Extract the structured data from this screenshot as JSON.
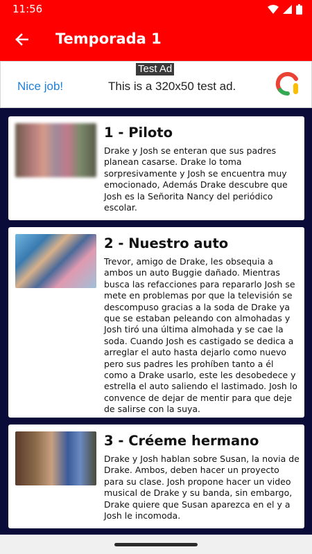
{
  "status_bar": {
    "time": "11:56"
  },
  "app_bar": {
    "title": "Temporada 1",
    "back_icon": "arrow-back-icon"
  },
  "ad": {
    "tag": "Test Ad",
    "nice": "Nice job!",
    "text": "This is a 320x50 test ad."
  },
  "episodes": [
    {
      "title": "1 - Piloto",
      "description": "Drake y Josh se enteran que sus padres planean casarse. Drake lo toma sorpresivamente y Josh se encuentra muy emocionado, Además Drake descubre que Josh es la Señorita Nancy del periódico escolar."
    },
    {
      "title": "2 - Nuestro auto",
      "description": "Trevor, amigo de Drake, les obsequia a ambos un auto Buggie dañado. Mientras busca las refacciones para repararlo Josh se mete en problemas por que la televisión se descompuso gracias a la soda de Drake ya que se estaban peleando con almohadas y Josh tiró una última almohada y se cae la soda. Cuando Josh es castigado se dedica a arreglar el auto hasta dejarlo como nuevo pero sus padres les prohíben tanto a él como a Drake usarlo, este les desobedece y estrella el auto saliendo el lastimado. Josh lo convence de dejar de mentir para que deje de salirse con la suya."
    },
    {
      "title": "3 - Créeme hermano",
      "description": "Drake y Josh hablan sobre Susan, la novia de Drake. Ambos, deben hacer un proyecto para su clase. Josh propone hacer un video musical de Drake y su banda, sin embargo, Drake quiere que Susan aparezca en el y a Josh le incomoda."
    }
  ],
  "colors": {
    "primary": "#ff0000",
    "background": "#0b0b3a",
    "card": "#ffffff",
    "ad_blue": "#1e7fd6"
  }
}
